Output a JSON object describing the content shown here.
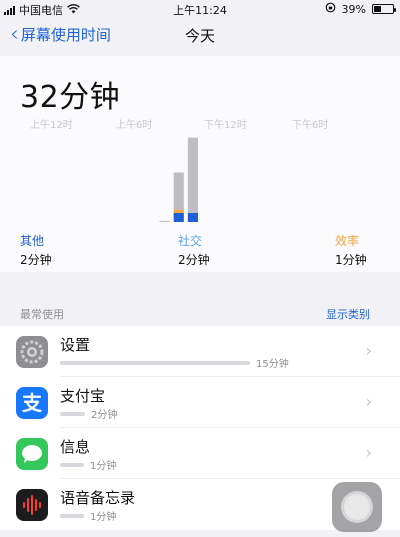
{
  "status_bar": {
    "carrier": "中国电信",
    "time": "上午11:24",
    "battery_percent": "39%",
    "battery_level": 0.39,
    "icons": [
      "signal-icon",
      "wifi-icon",
      "orientation-lock-icon",
      "battery-icon"
    ]
  },
  "nav": {
    "back_label": "屏幕使用时间",
    "title": "今天"
  },
  "summary": {
    "total": "32分钟"
  },
  "chart_data": {
    "type": "bar",
    "x_ticks": [
      "上午12时",
      "上午6时",
      "下午12时",
      "下午6时"
    ],
    "series": [
      {
        "name": "社交",
        "color": "#1f5fd8"
      },
      {
        "name": "效率",
        "color": "#f4a340"
      },
      {
        "name": "其他",
        "color": "#bdbdc2"
      }
    ],
    "bars": [
      {
        "hour": 9,
        "社交": 0,
        "效率": 0,
        "其他": 1
      },
      {
        "hour": 10,
        "社交": 8,
        "效率": 3,
        "其他": 33
      },
      {
        "hour": 11,
        "社交": 8,
        "效率": 0,
        "其他": 67
      }
    ],
    "ylim": [
      0,
      80
    ]
  },
  "categories": [
    {
      "name": "其他",
      "value": "2分钟",
      "color": "#1f5fd8"
    },
    {
      "name": "社交",
      "value": "2分钟",
      "color": "#5aa3f0"
    },
    {
      "name": "效率",
      "value": "1分钟",
      "color": "#f4a340"
    }
  ],
  "most_used": {
    "header": "最常使用",
    "show_categories": "显示类别",
    "apps": [
      {
        "name": "设置",
        "time": "15分钟",
        "usage": 0.62,
        "icon": "settings-icon"
      },
      {
        "name": "支付宝",
        "time": "2分钟",
        "usage": 0.08,
        "icon": "alipay-icon",
        "glyph": "支"
      },
      {
        "name": "信息",
        "time": "1分钟",
        "usage": 0.05,
        "icon": "messages-icon"
      },
      {
        "name": "语音备忘录",
        "time": "1分钟",
        "usage": 0.05,
        "icon": "voice-memos-icon"
      }
    ]
  }
}
